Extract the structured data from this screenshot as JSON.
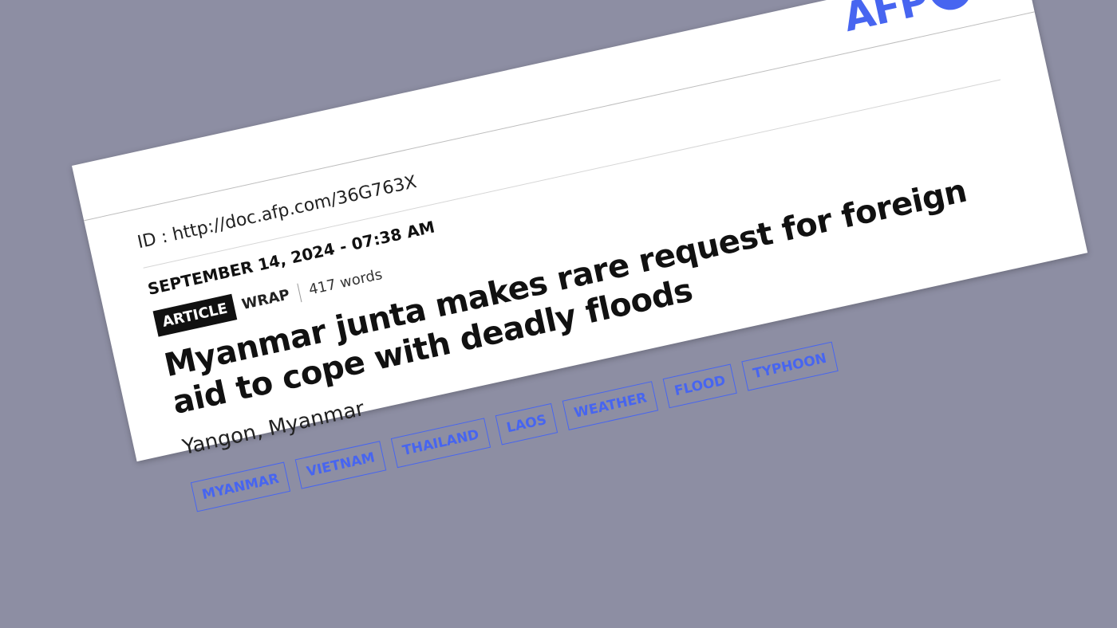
{
  "brand": {
    "name": "AFP",
    "color": "#4765f0",
    "dot_icon": "circle"
  },
  "doc_id": "ID : http://doc.afp.com/36G763X",
  "date": "SEPTEMBER 14, 2024 - 07:38 AM",
  "meta": {
    "type_badge": "ARTICLE",
    "genre": "WRAP",
    "word_count": "417 words"
  },
  "headline": "Myanmar junta makes rare request for foreign aid to cope with deadly floods",
  "location": "Yangon, Myanmar",
  "tags": [
    "MYANMAR",
    "VIETNAM",
    "THAILAND",
    "LAOS",
    "WEATHER",
    "FLOOD",
    "TYPHOON"
  ]
}
